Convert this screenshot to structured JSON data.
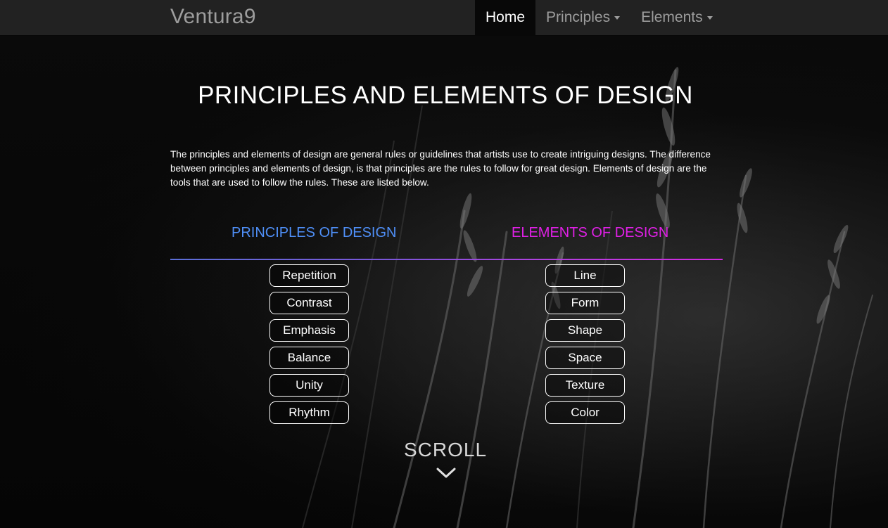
{
  "navbar": {
    "brand": "Ventura9",
    "items": [
      {
        "label": "Home",
        "active": true
      },
      {
        "label": "Principles",
        "dropdown": true
      },
      {
        "label": "Elements",
        "dropdown": true
      }
    ]
  },
  "main": {
    "title": "PRINCIPLES AND ELEMENTS OF DESIGN",
    "intro": "The principles and elements of design are general rules or guidelines that artists use to create intriguing designs. The difference between principles and elements of design, is that principles are the rules to follow for great design. Elements of design are the tools that are used to follow the rules. These are listed below.",
    "principles": {
      "heading": "PRINCIPLES OF DESIGN",
      "color": "#4f8ff7",
      "items": [
        "Repetition",
        "Contrast",
        "Emphasis",
        "Balance",
        "Unity",
        "Rhythm"
      ]
    },
    "elements": {
      "heading": "ELEMENTS OF DESIGN",
      "color": "#e020e6",
      "items": [
        "Line",
        "Form",
        "Shape",
        "Space",
        "Texture",
        "Color"
      ]
    },
    "scroll_label": "SCROLL",
    "scroll_icon": "chevron-down-icon"
  }
}
